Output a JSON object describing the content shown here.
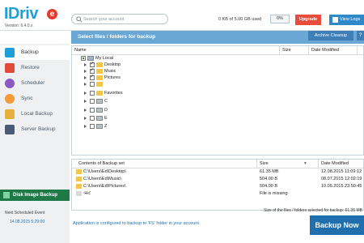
{
  "brand": {
    "logo_text": "IDriv",
    "logo_e": "e",
    "version": "Version: 6.4.0.x"
  },
  "search": {
    "placeholder": "Search your account"
  },
  "account": {
    "usage": "0 KB of 5.00 GB used",
    "percent": "0%",
    "upgrade_label": "Upgrade",
    "view_logs_label": "View Logs"
  },
  "sidebar": {
    "items": [
      {
        "label": "Backup",
        "icon": "backup-icon",
        "color": "#1f9fd8",
        "active": true
      },
      {
        "label": "Restore",
        "icon": "restore-icon",
        "color": "#e04b3a"
      },
      {
        "label": "Scheduler",
        "icon": "scheduler-icon",
        "color": "#8b5ac0"
      },
      {
        "label": "Sync",
        "icon": "sync-icon",
        "color": "#f39a3a"
      },
      {
        "label": "Local Backup",
        "icon": "local-backup-icon",
        "color": "#e6b03c"
      },
      {
        "label": "Server Backup",
        "icon": "server-backup-icon",
        "color": "#4a5a73"
      }
    ],
    "disk_image_label": "Disk Image Backup",
    "next_event_label": "Next Scheduled Event",
    "next_event_date": "14.08.2015 5:29:00"
  },
  "main": {
    "header_title": "Select files / folders for backup",
    "archive_label": "Archive Cleanup",
    "help_label": "?",
    "tree_columns": {
      "name": "Name",
      "size": "Size",
      "date": "Date Modified"
    },
    "tree": [
      {
        "label": "My Local",
        "level": 0,
        "expanded": true,
        "check": "partial",
        "kind": "root"
      },
      {
        "label": "Desktop",
        "level": 1,
        "check": "checked",
        "kind": "folder"
      },
      {
        "label": "Music",
        "level": 1,
        "check": "checked",
        "kind": "folder"
      },
      {
        "label": "Pictures",
        "level": 1,
        "check": "checked",
        "kind": "folder"
      },
      {
        "label": " ",
        "level": 1,
        "check": "none",
        "kind": "folder"
      },
      {
        "label": "Favorites",
        "level": 1,
        "check": "none",
        "kind": "folder"
      },
      {
        "label": "C",
        "level": 1,
        "check": "none",
        "kind": "drive"
      },
      {
        "label": "D",
        "level": 1,
        "check": "none",
        "kind": "drive"
      },
      {
        "label": "E",
        "level": 1,
        "check": "none",
        "kind": "drive"
      },
      {
        "label": "Z",
        "level": 1,
        "check": "none",
        "kind": "drive"
      }
    ],
    "set_columns": {
      "contents": "Contents of Backup set",
      "size": "Size",
      "date": "Date Modified"
    },
    "backup_set": [
      {
        "path": "C:\\Users\\Ed\\Desktop\\",
        "size": "61.35 MB",
        "date": "12.08.2015 11:09:12"
      },
      {
        "path": "C:\\Users\\Ed\\Music\\",
        "size": "504.00 B",
        "date": "08.07.2015 12:02:19"
      },
      {
        "path": "C:\\Users\\Ed\\Pictures\\",
        "size": "504.00 B",
        "date": "10.05.2015 23:50:45"
      },
      {
        "path": "ۥHՀ",
        "size": "File is missing",
        "date": ""
      }
    ],
    "set_footer": "Size of the files / folders selected for backup: 61.35 MB",
    "status_message": "Application is configured to backup to 'FS' folder in your account.",
    "backup_now_label": "Backup Now"
  }
}
